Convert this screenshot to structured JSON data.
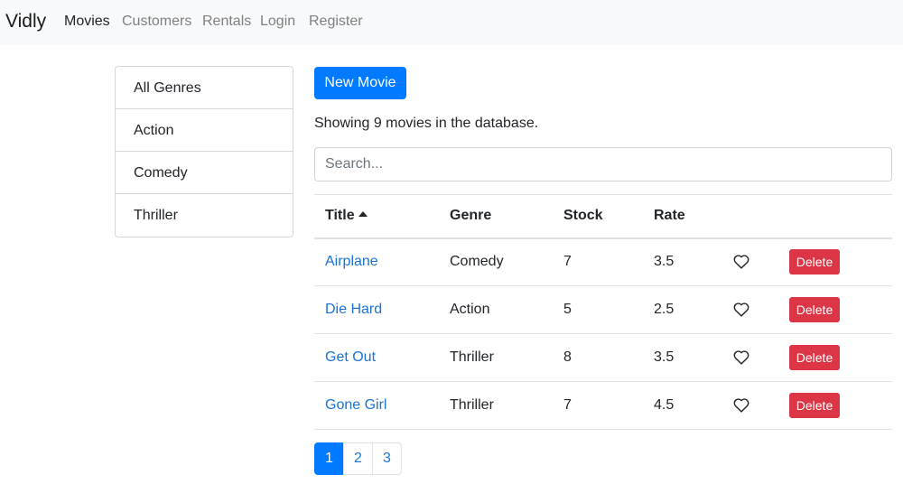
{
  "navbar": {
    "brand": "Vidly",
    "links": [
      "Movies",
      "Customers",
      "Rentals",
      "Login",
      "Register"
    ],
    "active": "Movies"
  },
  "genres": [
    "All Genres",
    "Action",
    "Comedy",
    "Thriller"
  ],
  "toolbar": {
    "new_movie_label": "New Movie"
  },
  "summary": "Showing 9 movies in the database.",
  "search": {
    "placeholder": "Search...",
    "value": ""
  },
  "table": {
    "columns": [
      "Title",
      "Genre",
      "Stock",
      "Rate"
    ],
    "sorted_by": "Title",
    "sort_direction": "asc",
    "delete_label": "Delete",
    "rows": [
      {
        "title": "Airplane",
        "genre": "Comedy",
        "stock": "7",
        "rate": "3.5",
        "liked": false
      },
      {
        "title": "Die Hard",
        "genre": "Action",
        "stock": "5",
        "rate": "2.5",
        "liked": false
      },
      {
        "title": "Get Out",
        "genre": "Thriller",
        "stock": "8",
        "rate": "3.5",
        "liked": false
      },
      {
        "title": "Gone Girl",
        "genre": "Thriller",
        "stock": "7",
        "rate": "4.5",
        "liked": false
      }
    ]
  },
  "pagination": {
    "pages": [
      "1",
      "2",
      "3"
    ],
    "current": "1"
  },
  "colors": {
    "primary": "#007bff",
    "danger": "#dc3545",
    "link": "#1a73d6",
    "navbar_bg": "#f8f9fa"
  }
}
